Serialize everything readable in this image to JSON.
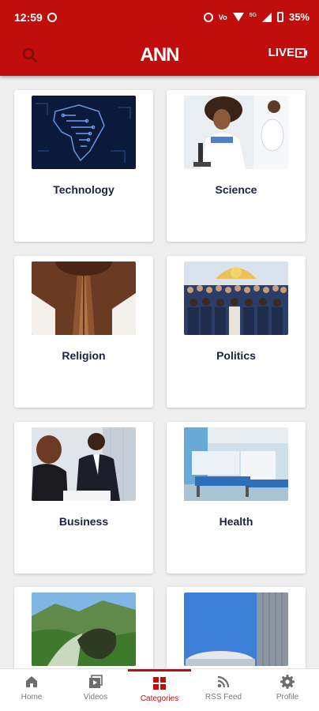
{
  "status_bar": {
    "time": "12:59",
    "battery": "35%"
  },
  "app_bar": {
    "logo": "ANN",
    "live_label": "LIVE"
  },
  "categories": [
    {
      "label": "Technology"
    },
    {
      "label": "Science"
    },
    {
      "label": "Religion"
    },
    {
      "label": "Politics"
    },
    {
      "label": "Business"
    },
    {
      "label": "Health"
    },
    {
      "label": ""
    },
    {
      "label": ""
    }
  ],
  "bottom_nav": {
    "items": [
      {
        "label": "Home",
        "icon": "home-icon"
      },
      {
        "label": "Videos",
        "icon": "videos-icon"
      },
      {
        "label": "Categories",
        "icon": "categories-icon"
      },
      {
        "label": "RSS Feed",
        "icon": "rss-icon"
      },
      {
        "label": "Profile",
        "icon": "gear-icon"
      }
    ],
    "active": "Categories"
  },
  "colors": {
    "brand": "#c20d0d",
    "card_text": "#1c2340",
    "background": "#efefef"
  }
}
